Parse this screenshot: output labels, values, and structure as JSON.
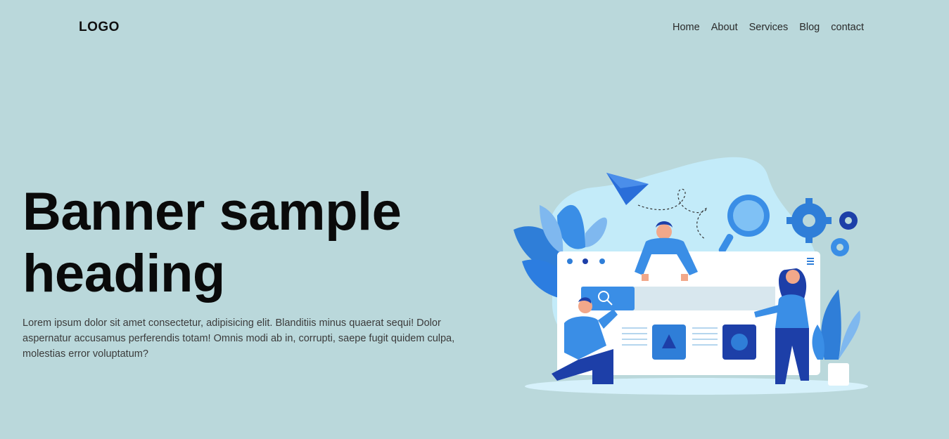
{
  "header": {
    "logo": "LOGO",
    "nav": [
      "Home",
      "About",
      "Services",
      "Blog",
      "contact"
    ]
  },
  "banner": {
    "heading_line1": "Banner sample",
    "heading_line2": "heading",
    "text": "Lorem ipsum dolor sit amet consectetur, adipisicing elit. Blanditiis minus quaerat sequi! Dolor aspernatur accusamus perferendis totam! Omnis modi ab in, corrupti, saepe fugit quidem culpa, molestias error voluptatum?"
  },
  "colors": {
    "background": "#bad8db",
    "accent_blue": "#3a8ee6",
    "dark_blue": "#1d3fa8",
    "light_blue": "#cdeefa"
  },
  "illustration": {
    "icons": [
      "paper-plane-icon",
      "magnifier-icon",
      "gear-icon",
      "search-icon",
      "triangle-icon",
      "circle-icon",
      "hamburger-icon",
      "plant-icon",
      "leaf-icon"
    ]
  }
}
